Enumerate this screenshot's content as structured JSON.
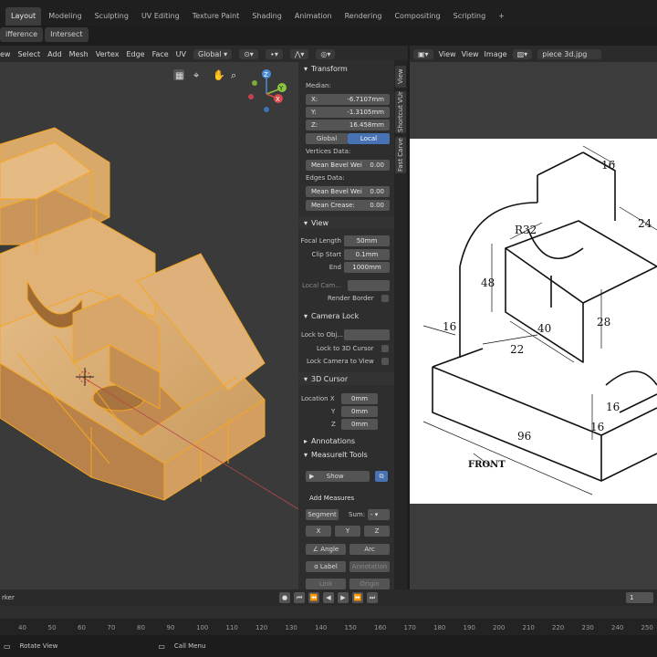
{
  "workspace_tabs": [
    "Layout",
    "Modeling",
    "Sculpting",
    "UV Editing",
    "Texture Paint",
    "Shading",
    "Animation",
    "Rendering",
    "Compositing",
    "Scripting"
  ],
  "add_tab": "+",
  "bool_buttons": [
    "ifference",
    "Intersect"
  ],
  "viewport_menu": [
    "ew",
    "Select",
    "Add",
    "Mesh",
    "Vertex",
    "Edge",
    "Face",
    "UV"
  ],
  "orientation": "Global",
  "image_editor": {
    "menus": [
      "View",
      "View",
      "Image"
    ],
    "filename": "piece 3d.jpg"
  },
  "npanel": {
    "transform": {
      "header": "Transform",
      "median": "Median:",
      "x_label": "X:",
      "x": "-6.7107mm",
      "y_label": "Y:",
      "y": "-1.3105mm",
      "z_label": "Z:",
      "z": "16.458mm",
      "global": "Global",
      "local": "Local",
      "vertices_data": "Vertices Data:",
      "mean_bevel_weight_label": "Mean Bevel Wei",
      "mean_bevel_weight": "0.00",
      "edges_data": "Edges Data:",
      "edge_bevel_weight_label": "Mean Bevel Wei",
      "edge_bevel_weight": "0.00",
      "mean_crease_label": "Mean Crease:",
      "mean_crease": "0.00"
    },
    "view": {
      "header": "View",
      "focal_length_label": "Focal Length",
      "focal_length": "50mm",
      "clip_start_label": "Clip Start",
      "clip_start": "0.1mm",
      "end_label": "End",
      "end": "1000mm",
      "local_camera_label": "Local Cam...",
      "render_border_label": "Render Border"
    },
    "camera_lock": {
      "header": "Camera Lock",
      "lock_to_object_label": "Lock to Obj...",
      "lock_to_3d_cursor_label": "Lock to 3D Cursor",
      "lock_camera_to_view_label": "Lock Camera to View"
    },
    "cursor": {
      "header": "3D Cursor",
      "location_x_label": "Location X",
      "x": "0mm",
      "y_label": "Y",
      "y": "0mm",
      "z_label": "Z",
      "z": "0mm"
    },
    "annotations": {
      "header": "Annotations"
    },
    "measureit": {
      "header": "MeasureIt Tools",
      "show": "Show",
      "add_measures": "Add Measures",
      "segment": "Segment",
      "sum_label": "Sum:",
      "sum_value": "-",
      "x": "X",
      "y": "Y",
      "z": "Z",
      "angle": "Angle",
      "arc": "Arc",
      "label": "Label",
      "annotation": "Annotation",
      "link": "Link",
      "origin": "Origin"
    }
  },
  "sidebar_tabs": [
    "View",
    "Shortcut VUr",
    "Fast Carve"
  ],
  "gizmo": {
    "x": "X",
    "y": "Y",
    "z": "Z"
  },
  "drawing": {
    "dims": [
      "16",
      "24",
      "R32",
      "48",
      "28",
      "40",
      "16",
      "22",
      "16",
      "16",
      "96"
    ],
    "front_label": "FRONT"
  },
  "timeline": {
    "left_text": "rker",
    "right_frame": "1"
  },
  "ruler_ticks": [
    "40",
    "50",
    "60",
    "70",
    "80",
    "90",
    "100",
    "110",
    "120",
    "130",
    "140",
    "150",
    "160",
    "170",
    "180",
    "190",
    "200",
    "210",
    "220",
    "230",
    "240",
    "250"
  ],
  "statusbar": {
    "rotate_view": "Rotate View",
    "call_menu": "Call Menu"
  },
  "colors": {
    "accent": "#4772b3",
    "mesh_face": "#e0b278",
    "mesh_edge": "#f5a623",
    "background": "#3a3a3a"
  }
}
